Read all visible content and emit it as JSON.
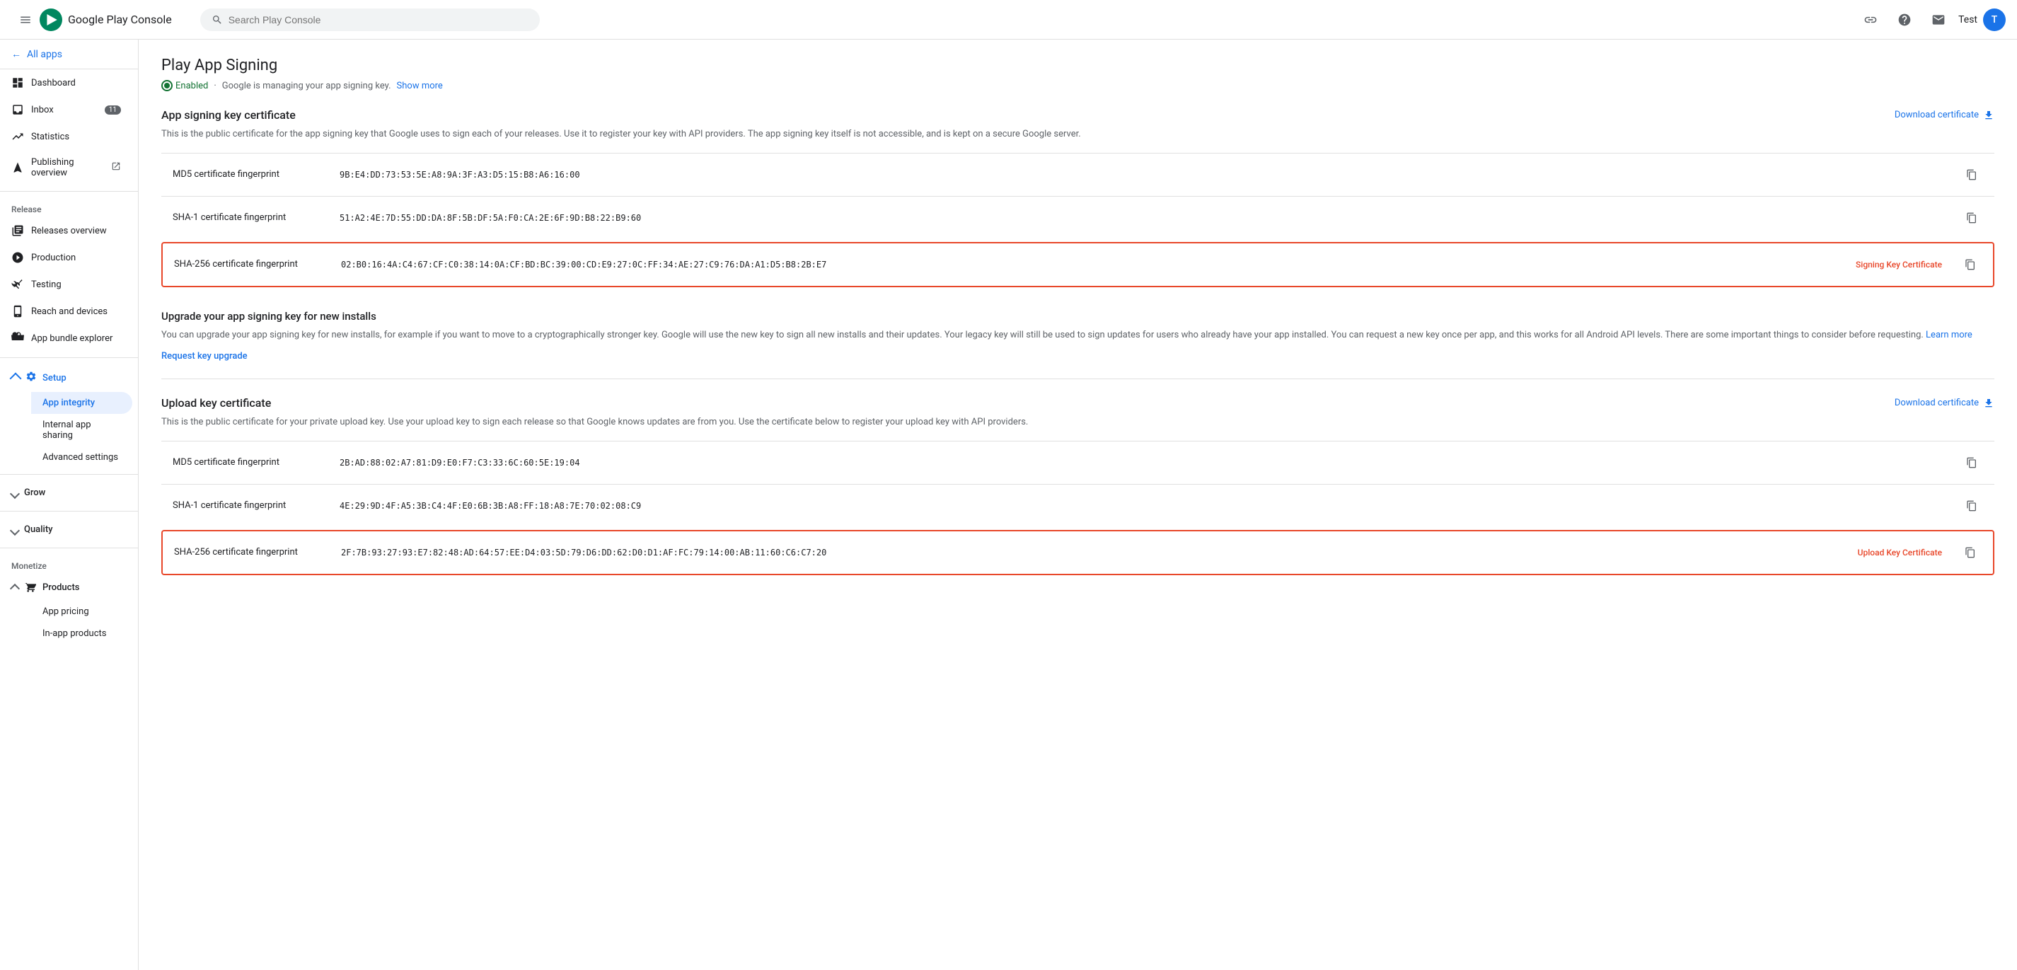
{
  "topbar": {
    "logo_text": "Google Play Console",
    "search_placeholder": "Search Play Console",
    "user_label": "Test",
    "user_initial": "T"
  },
  "sidebar": {
    "all_apps_label": "All apps",
    "nav_items": [
      {
        "id": "dashboard",
        "label": "Dashboard",
        "icon": "dashboard"
      },
      {
        "id": "inbox",
        "label": "Inbox",
        "icon": "inbox",
        "badge": "11"
      },
      {
        "id": "statistics",
        "label": "Statistics",
        "icon": "statistics"
      },
      {
        "id": "publishing-overview",
        "label": "Publishing overview",
        "icon": "publishing"
      }
    ],
    "release_label": "Release",
    "release_items": [
      {
        "id": "releases-overview",
        "label": "Releases overview",
        "icon": "releases"
      },
      {
        "id": "production",
        "label": "Production",
        "icon": "production"
      },
      {
        "id": "testing",
        "label": "Testing",
        "icon": "testing"
      },
      {
        "id": "reach-devices",
        "label": "Reach and devices",
        "icon": "reach"
      },
      {
        "id": "app-bundle",
        "label": "App bundle explorer",
        "icon": "bundle"
      }
    ],
    "setup_label": "Setup",
    "setup_items": [
      {
        "id": "app-integrity",
        "label": "App integrity",
        "active": true
      },
      {
        "id": "internal-app-sharing",
        "label": "Internal app sharing"
      },
      {
        "id": "advanced-settings",
        "label": "Advanced settings"
      }
    ],
    "grow_label": "Grow",
    "quality_label": "Quality",
    "monetize_label": "Monetize",
    "products_label": "Products",
    "products_items": [
      {
        "id": "app-pricing",
        "label": "App pricing"
      },
      {
        "id": "in-app-products",
        "label": "In-app products"
      }
    ]
  },
  "main": {
    "page_title": "Play App Signing",
    "status_text": "Enabled",
    "status_desc": "Google is managing your app signing key.",
    "show_more": "Show more",
    "app_signing_section": {
      "title": "App signing key certificate",
      "download_label": "Download certificate",
      "description": "This is the public certificate for the app signing key that Google uses to sign each of your releases. Use it to register your key with API providers. The app signing key itself is not accessible, and is kept on a secure Google server.",
      "rows": [
        {
          "label": "MD5 certificate fingerprint",
          "value": "9B:E4:DD:73:53:5E:A8:9A:3F:A3:D5:15:B8:A6:16:00",
          "highlighted": false
        },
        {
          "label": "SHA-1 certificate fingerprint",
          "value": "51:A2:4E:7D:55:DD:DA:8F:5B:DF:5A:F0:CA:2E:6F:9D:B8:22:B9:60",
          "highlighted": false
        },
        {
          "label": "SHA-256 certificate fingerprint",
          "value": "02:B0:16:4A:C4:67:CF:C0:38:14:0A:CF:BD:BC:39:00:CD:E9:27:0C:FF:34:AE:27:C9:76:DA:A1:D5:B8:2B:E7",
          "highlighted": true,
          "badge": "Signing Key Certificate"
        }
      ]
    },
    "upgrade_section": {
      "title": "Upgrade your app signing key for new installs",
      "description": "You can upgrade your app signing key for new installs, for example if you want to move to a cryptographically stronger key. Google will use the new key to sign all new installs and their updates. Your legacy key will still be used to sign updates for users who already have your app installed. You can request a new key once per app, and this works for all Android API levels. There are some important things to consider before requesting.",
      "learn_more": "Learn more",
      "request_link": "Request key upgrade"
    },
    "upload_section": {
      "title": "Upload key certificate",
      "download_label": "Download certificate",
      "description": "This is the public certificate for your private upload key. Use your upload key to sign each release so that Google knows updates are from you. Use the certificate below to register your upload key with API providers.",
      "rows": [
        {
          "label": "MD5 certificate fingerprint",
          "value": "2B:AD:88:02:A7:81:D9:E0:F7:C3:33:6C:60:5E:19:04",
          "highlighted": false
        },
        {
          "label": "SHA-1 certificate fingerprint",
          "value": "4E:29:9D:4F:A5:3B:C4:4F:E0:6B:3B:A8:FF:18:A8:7E:70:02:08:C9",
          "highlighted": false
        },
        {
          "label": "SHA-256 certificate fingerprint",
          "value": "2F:7B:93:27:93:E7:82:48:AD:64:57:EE:D4:03:5D:79:D6:DD:62:D0:D1:AF:FC:79:14:00:AB:11:60:C6:C7:20",
          "highlighted": true,
          "badge": "Upload Key Certificate"
        }
      ]
    }
  }
}
